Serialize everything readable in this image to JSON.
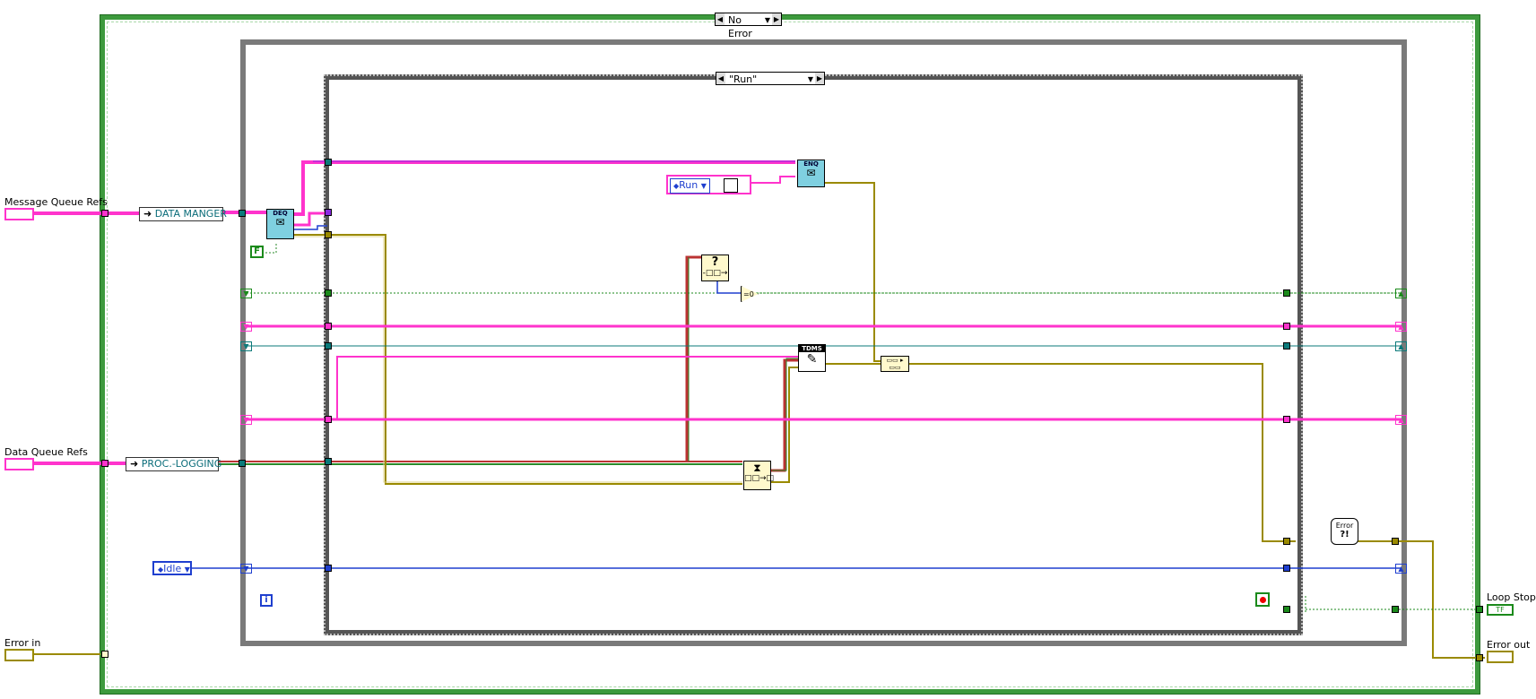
{
  "case_outer": {
    "selector_label": "No Error"
  },
  "case_inner": {
    "selector_label": "\"Run\""
  },
  "controls": {
    "message_queue_refs": "Message Queue Refs",
    "data_queue_refs": "Data Queue Refs",
    "error_in": "Error in",
    "loop_stop": "Loop Stop?",
    "error_out": "Error out"
  },
  "constants": {
    "data_manager": "DATA MANGER",
    "proc_logging": "PROC.-LOGGING",
    "idle_enum": "Idle",
    "run_enum": "Run",
    "false_const": "F",
    "loop_stop_tf": "TF",
    "iteration": "i"
  },
  "nodes": {
    "deq": "DEQ",
    "enq": "ENQ",
    "tdms": "TDMS",
    "error_node": "Error"
  },
  "colors": {
    "cluster_pink": "#ff33cc",
    "error_yellow": "#9a8a00",
    "enum_blue": "#1f3fcf",
    "bool_green": "#1b8a1b",
    "refnum_teal": "#0b7a7a",
    "frame_green": "#3d9a3d"
  }
}
